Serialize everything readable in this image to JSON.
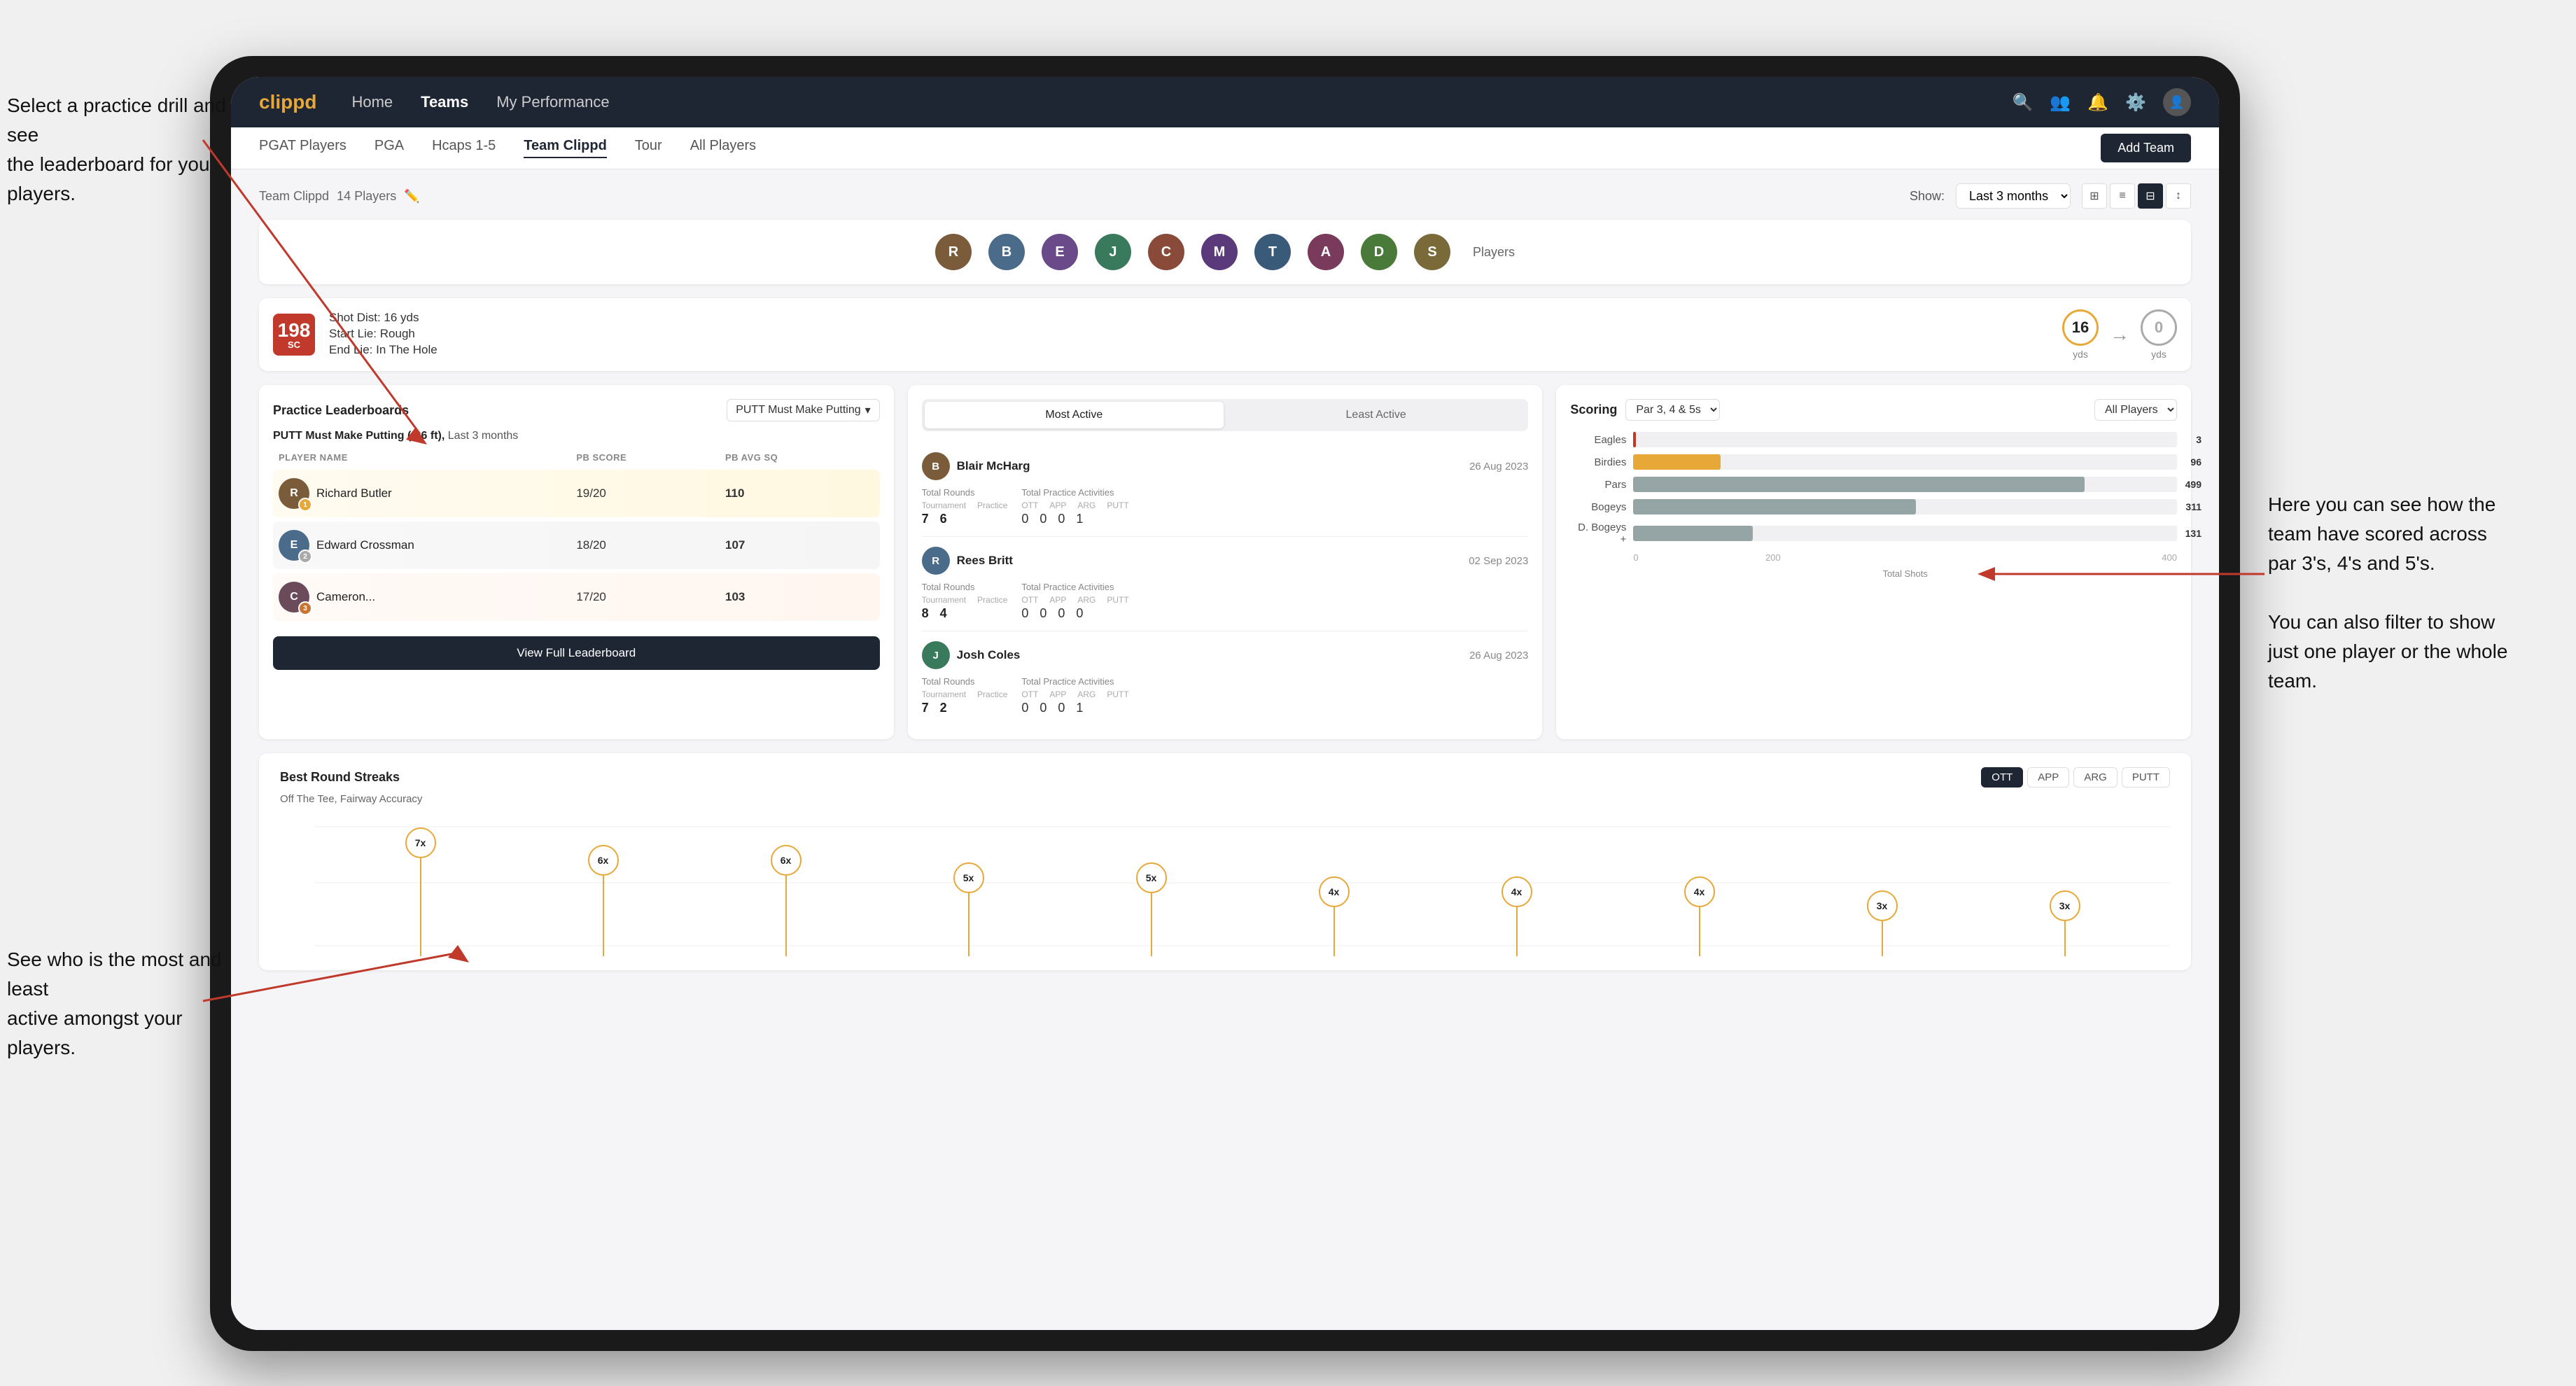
{
  "annotations": {
    "top_left": {
      "line1": "Select a practice drill and see",
      "line2": "the leaderboard for you players."
    },
    "bottom_left": {
      "line1": "See who is the most and least",
      "line2": "active amongst your players."
    },
    "right": {
      "line1": "Here you can see how the",
      "line2": "team have scored across",
      "line3": "par 3's, 4's and 5's.",
      "line4": "",
      "line5": "You can also filter to show",
      "line6": "just one player or the whole",
      "line7": "team."
    }
  },
  "navbar": {
    "logo": "clippd",
    "links": [
      "Home",
      "Teams",
      "My Performance"
    ],
    "active_link": "Teams"
  },
  "subnav": {
    "tabs": [
      "PGAT Players",
      "PGA",
      "Hcaps 1-5",
      "Team Clippd",
      "Tour",
      "All Players"
    ],
    "active_tab": "Team Clippd",
    "add_team_label": "Add Team"
  },
  "team_section": {
    "title": "Team Clippd",
    "player_count": "14 Players",
    "show_label": "Show:",
    "show_value": "Last 3 months",
    "players_label": "Players"
  },
  "shot_info": {
    "badge_num": "198",
    "badge_sub": "SC",
    "line1": "Shot Dist: 16 yds",
    "line2": "Start Lie: Rough",
    "line3": "End Lie: In The Hole",
    "circle1_val": "16",
    "circle1_lbl": "yds",
    "circle2_val": "0",
    "circle2_lbl": "yds"
  },
  "practice_leaderboard": {
    "title": "Practice Leaderboards",
    "filter": "PUTT Must Make Putting",
    "subtitle_drill": "PUTT Must Make Putting (3-6 ft),",
    "subtitle_period": "Last 3 months",
    "col_player": "PLAYER NAME",
    "col_score": "PB SCORE",
    "col_avg": "PB AVG SQ",
    "players": [
      {
        "name": "Richard Butler",
        "rank": "1",
        "rank_type": "gold",
        "score": "19/20",
        "avg": "110"
      },
      {
        "name": "Edward Crossman",
        "rank": "2",
        "rank_type": "silver",
        "score": "18/20",
        "avg": "107"
      },
      {
        "name": "Cameron...",
        "rank": "3",
        "rank_type": "bronze",
        "score": "17/20",
        "avg": "103"
      }
    ],
    "view_btn": "View Full Leaderboard"
  },
  "activity": {
    "toggle_most": "Most Active",
    "toggle_least": "Least Active",
    "active_toggle": "most",
    "players": [
      {
        "name": "Blair McHarg",
        "date": "26 Aug 2023",
        "total_rounds_label": "Total Rounds",
        "tournament": "7",
        "practice": "6",
        "practice_label": "Practice",
        "total_practice_label": "Total Practice Activities",
        "ott": "0",
        "app": "0",
        "arg": "0",
        "putt": "1"
      },
      {
        "name": "Rees Britt",
        "date": "02 Sep 2023",
        "total_rounds_label": "Total Rounds",
        "tournament": "8",
        "practice": "4",
        "practice_label": "Practice",
        "total_practice_label": "Total Practice Activities",
        "ott": "0",
        "app": "0",
        "arg": "0",
        "putt": "0"
      },
      {
        "name": "Josh Coles",
        "date": "26 Aug 2023",
        "total_rounds_label": "Total Rounds",
        "tournament": "7",
        "practice": "2",
        "practice_label": "Practice",
        "total_practice_label": "Total Practice Activities",
        "ott": "0",
        "app": "0",
        "arg": "0",
        "putt": "1"
      }
    ]
  },
  "scoring": {
    "title": "Scoring",
    "filter1": "Par 3, 4 & 5s",
    "filter2": "All Players",
    "bars": [
      {
        "label": "Eagles",
        "value": 3,
        "max": 600,
        "type": "eagles"
      },
      {
        "label": "Birdies",
        "value": 96,
        "max": 600,
        "type": "birdies"
      },
      {
        "label": "Pars",
        "value": 499,
        "max": 600,
        "type": "pars"
      },
      {
        "label": "Bogeys",
        "value": 311,
        "max": 600,
        "type": "bogeys"
      },
      {
        "label": "D. Bogeys +",
        "value": 131,
        "max": 600,
        "type": "dbogeys"
      }
    ],
    "x_axis_label": "Total Shots",
    "x_ticks": [
      "0",
      "200",
      "400"
    ]
  },
  "streaks": {
    "title": "Best Round Streaks",
    "buttons": [
      "OTT",
      "APP",
      "ARG",
      "PUTT"
    ],
    "active_btn": "OTT",
    "subtitle": "Off The Tee, Fairway Accuracy",
    "dots": [
      {
        "label": "7x",
        "height": 140
      },
      {
        "label": "6x",
        "height": 115
      },
      {
        "label": "6x",
        "height": 115
      },
      {
        "label": "5x",
        "height": 90
      },
      {
        "label": "5x",
        "height": 90
      },
      {
        "label": "4x",
        "height": 70
      },
      {
        "label": "4x",
        "height": 70
      },
      {
        "label": "4x",
        "height": 70
      },
      {
        "label": "3x",
        "height": 50
      },
      {
        "label": "3x",
        "height": 50
      }
    ]
  }
}
